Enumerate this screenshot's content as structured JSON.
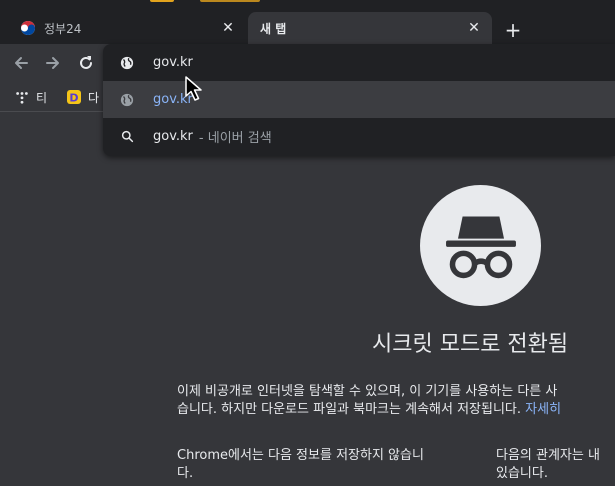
{
  "tabs": [
    {
      "title": "정부24",
      "icon": "gov24-emblem-icon"
    },
    {
      "title": "새 탭",
      "icon": "none"
    }
  ],
  "toolbar": {
    "back_icon": "arrow-left-icon",
    "forward_icon": "arrow-right-icon",
    "reload_icon": "reload-icon"
  },
  "bookmarks": [
    {
      "label": "티",
      "icon": "tistory-dots-icon"
    },
    {
      "label": "다",
      "icon": "daum-d-icon",
      "color": "#f5c518"
    }
  ],
  "omnibox": {
    "input_value": "gov.kr",
    "suggestions": [
      {
        "text": "gov.kr",
        "icon": "globe-icon"
      },
      {
        "text": "gov.kr",
        "icon": "globe-icon"
      },
      {
        "text": "gov.kr",
        "suffix": "- 네이버 검색",
        "icon": "search-icon"
      }
    ]
  },
  "incognito": {
    "title": "시크릿 모드로 전환됨",
    "para_line1": "이제 비공개로 인터넷을 탐색할 수 있으며, 이 기기를 사용하는 다른 사",
    "para_line2": "습니다. 하지만 다운로드 파일과 북마크는 계속해서 저장됩니다.",
    "para_link": "자세히",
    "col1_line1": "Chrome에서는 다음 정보를 저장하지 않습니",
    "col1_line2": "다.",
    "col2_line1": "다음의 관계자는 내",
    "col2_line2": "있습니다."
  },
  "colors": {
    "accent": "#8ab4f8",
    "frame": "#202124",
    "surface": "#35363a"
  }
}
